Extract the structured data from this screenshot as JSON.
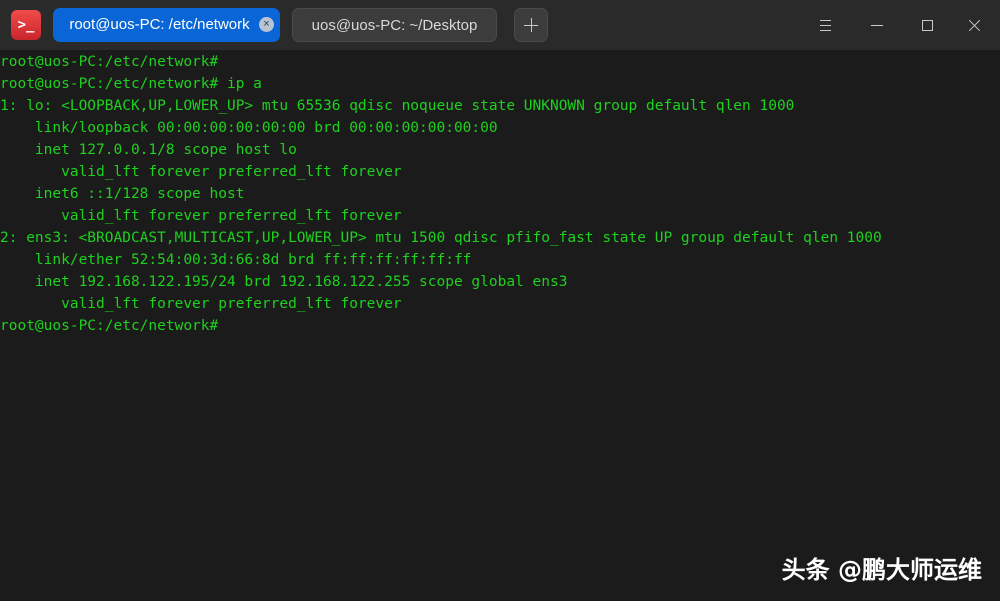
{
  "app": {
    "icon_name": "terminal-icon",
    "icon_glyph": ">_"
  },
  "tabs": [
    {
      "label": "root@uos-PC: /etc/network",
      "active": true
    },
    {
      "label": "uos@uos-PC: ~/Desktop",
      "active": false
    }
  ],
  "tab_close_glyph": "×",
  "window_controls": [
    "menu-icon",
    "minimize-icon",
    "maximize-icon",
    "close-icon"
  ],
  "terminal": {
    "lines": [
      "root@uos-PC:/etc/network#",
      "root@uos-PC:/etc/network# ip a",
      "1: lo: <LOOPBACK,UP,LOWER_UP> mtu 65536 qdisc noqueue state UNKNOWN group default qlen 1000",
      "    link/loopback 00:00:00:00:00:00 brd 00:00:00:00:00:00",
      "    inet 127.0.0.1/8 scope host lo",
      "       valid_lft forever preferred_lft forever",
      "    inet6 ::1/128 scope host",
      "       valid_lft forever preferred_lft forever",
      "2: ens3: <BROADCAST,MULTICAST,UP,LOWER_UP> mtu 1500 qdisc pfifo_fast state UP group default qlen 1000",
      "    link/ether 52:54:00:3d:66:8d brd ff:ff:ff:ff:ff:ff",
      "    inet 192.168.122.195/24 brd 192.168.122.255 scope global ens3",
      "       valid_lft forever preferred_lft forever",
      "root@uos-PC:/etc/network#"
    ],
    "text_color": "#1ed11e",
    "background": "#1b1b1b"
  },
  "watermark": "头条 @鹏大师运维",
  "colors": {
    "active_tab": "#0a66d6",
    "titlebar": "#2a2a2a",
    "app_icon": "#e03a3e"
  }
}
